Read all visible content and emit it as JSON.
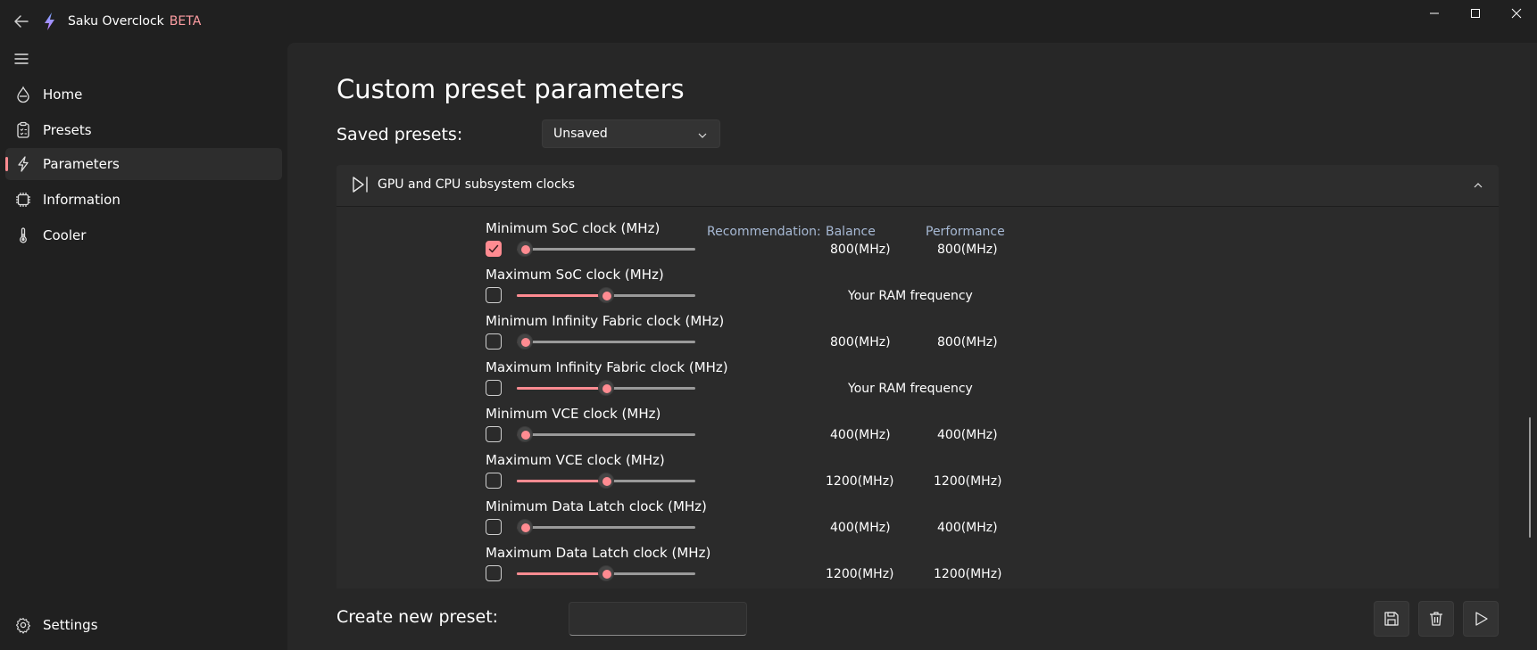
{
  "app": {
    "title": "Saku Overclock",
    "badge": "BETA",
    "accent": "#ff8b91"
  },
  "nav": {
    "items": [
      {
        "label": "Home",
        "icon": "home-icon",
        "active": false
      },
      {
        "label": "Presets",
        "icon": "presets-clipboard-icon",
        "active": false
      },
      {
        "label": "Parameters",
        "icon": "lightning-icon",
        "active": true
      },
      {
        "label": "Information",
        "icon": "chip-icon",
        "active": false
      },
      {
        "label": "Cooler",
        "icon": "thermometer-icon",
        "active": false
      }
    ],
    "settings_label": "Settings"
  },
  "page": {
    "title": "Custom preset parameters",
    "saved_presets_label": "Saved presets:",
    "saved_presets_value": "Unsaved"
  },
  "section": {
    "title": "GPU and CPU subsystem clocks",
    "recommendation_label": "Recommendation:",
    "col_balance": "Balance",
    "col_performance": "Performance",
    "params": [
      {
        "label": "Minimum SoC clock (MHz)",
        "checked": true,
        "slider": 0.0,
        "balance": "800(MHz)",
        "performance": "800(MHz)",
        "note": ""
      },
      {
        "label": "Maximum SoC clock (MHz)",
        "checked": false,
        "slider": 0.5,
        "balance": "",
        "performance": "",
        "note": "Your RAM frequency"
      },
      {
        "label": "Minimum Infinity Fabric clock (MHz)",
        "checked": false,
        "slider": 0.0,
        "balance": "800(MHz)",
        "performance": "800(MHz)",
        "note": ""
      },
      {
        "label": "Maximum Infinity Fabric clock (MHz)",
        "checked": false,
        "slider": 0.5,
        "balance": "",
        "performance": "",
        "note": "Your RAM frequency"
      },
      {
        "label": "Minimum VCE clock (MHz)",
        "checked": false,
        "slider": 0.0,
        "balance": "400(MHz)",
        "performance": "400(MHz)",
        "note": ""
      },
      {
        "label": "Maximum VCE clock (MHz)",
        "checked": false,
        "slider": 0.5,
        "balance": "1200(MHz)",
        "performance": "1200(MHz)",
        "note": ""
      },
      {
        "label": "Minimum Data Latch clock (MHz)",
        "checked": false,
        "slider": 0.0,
        "balance": "400(MHz)",
        "performance": "400(MHz)",
        "note": ""
      },
      {
        "label": "Maximum Data Latch clock (MHz)",
        "checked": false,
        "slider": 0.5,
        "balance": "1200(MHz)",
        "performance": "1200(MHz)",
        "note": ""
      }
    ]
  },
  "footer": {
    "create_label": "Create new preset:",
    "input_value": "",
    "buttons": [
      "save-icon",
      "trash-icon",
      "play-icon"
    ]
  }
}
